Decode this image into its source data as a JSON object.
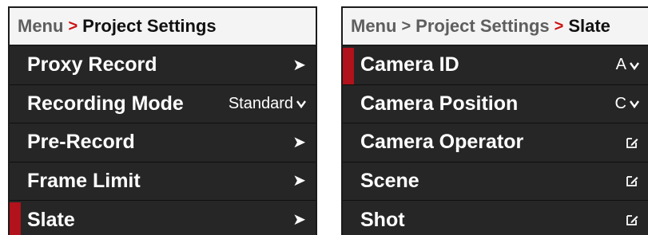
{
  "left": {
    "breadcrumb": {
      "root": "Menu",
      "separator": ">",
      "current": "Project Settings"
    },
    "items": [
      {
        "label": "Proxy Record",
        "value": "",
        "control": "chevron-right-icon",
        "selected": false
      },
      {
        "label": "Recording Mode",
        "value": "Standard",
        "control": "chevron-down-icon",
        "selected": false
      },
      {
        "label": "Pre-Record",
        "value": "",
        "control": "chevron-right-icon",
        "selected": false
      },
      {
        "label": "Frame Limit",
        "value": "",
        "control": "chevron-right-icon",
        "selected": false
      },
      {
        "label": "Slate",
        "value": "",
        "control": "chevron-right-icon",
        "selected": true
      }
    ]
  },
  "right": {
    "breadcrumb": {
      "root": "Menu",
      "separator1": ">",
      "middle": "Project Settings",
      "separator2": ">",
      "current": "Slate"
    },
    "items": [
      {
        "label": "Camera ID",
        "value": "A",
        "control": "chevron-down-icon",
        "selected": true
      },
      {
        "label": "Camera Position",
        "value": "C",
        "control": "chevron-down-icon",
        "selected": false
      },
      {
        "label": "Camera Operator",
        "value": "",
        "control": "edit-icon",
        "selected": false
      },
      {
        "label": "Scene",
        "value": "",
        "control": "edit-icon",
        "selected": false
      },
      {
        "label": "Shot",
        "value": "",
        "control": "edit-icon",
        "selected": false
      }
    ]
  },
  "colors": {
    "accent": "#b1121b",
    "separator_red": "#cc1111",
    "panel_bg": "#262626",
    "breadcrumb_bg": "#f4f4f4"
  }
}
